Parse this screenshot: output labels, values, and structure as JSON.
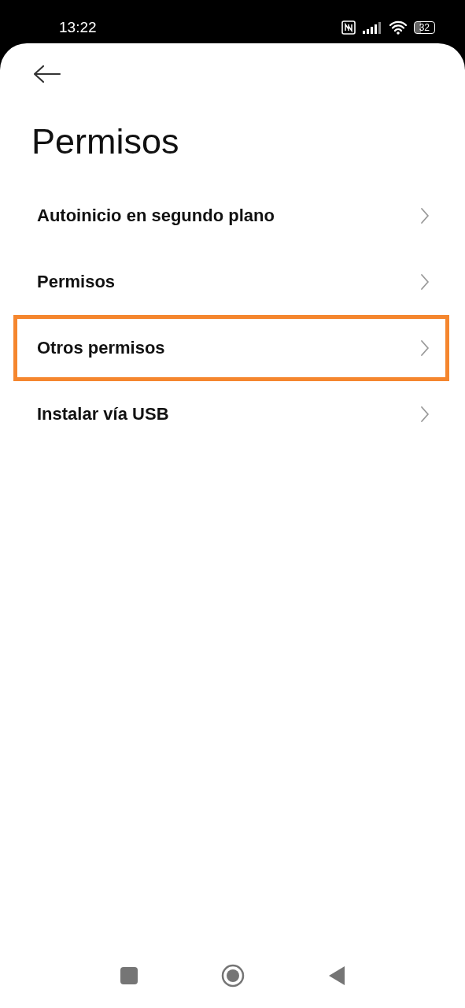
{
  "status_bar": {
    "time": "13:22",
    "battery": "32"
  },
  "title": "Permisos",
  "items": [
    {
      "label": "Autoinicio en segundo plano",
      "highlighted": false
    },
    {
      "label": "Permisos",
      "highlighted": false
    },
    {
      "label": "Otros permisos",
      "highlighted": true
    },
    {
      "label": "Instalar vía USB",
      "highlighted": false
    }
  ]
}
